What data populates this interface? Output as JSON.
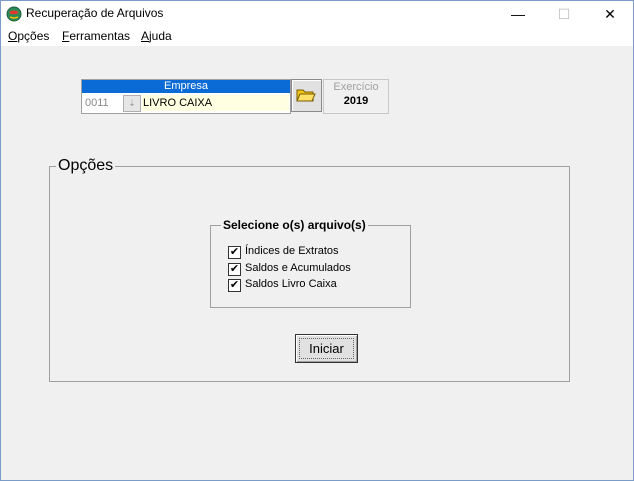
{
  "window": {
    "title": "Recuperação de Arquivos",
    "controls": {
      "minimize": "—",
      "maximize": "☐",
      "close": "✕"
    },
    "icon": "app-globe-icon"
  },
  "menu": {
    "items": [
      {
        "label_underlined": "O",
        "label_rest": "pções"
      },
      {
        "label_underlined": "F",
        "label_rest": "erramentas"
      },
      {
        "label_underlined": "A",
        "label_rest": "juda"
      }
    ]
  },
  "empresa": {
    "header": "Empresa",
    "code": "0011",
    "name": "LIVRO CAIXA",
    "header_color": "#0a6ad6",
    "name_bg_color": "#ffffe1"
  },
  "exercicio": {
    "label": "Exercício",
    "year": "2019"
  },
  "opcoes": {
    "legend": "Opções",
    "files_legend": "Selecione o(s) arquivo(s)",
    "files": [
      {
        "label": "Índices de Extratos",
        "checked": true
      },
      {
        "label": "Saldos e Acumulados",
        "checked": true
      },
      {
        "label": "Saldos Livro Caixa",
        "checked": true
      }
    ],
    "start_button": "Iniciar"
  }
}
